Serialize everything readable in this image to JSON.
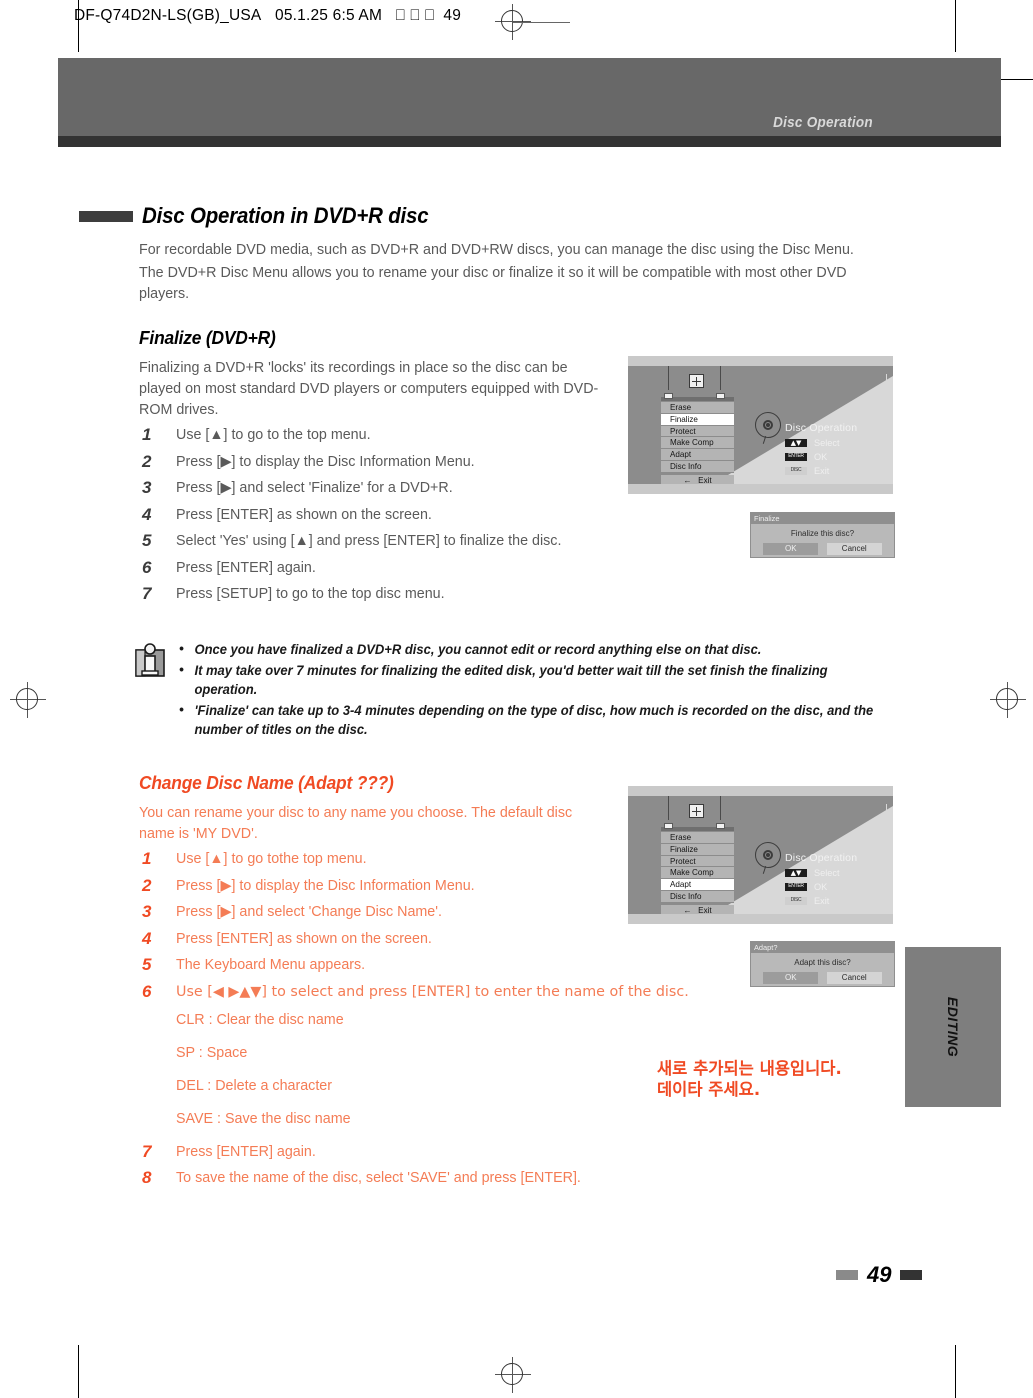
{
  "print_slug": {
    "job": "DF-Q74D2N-LS(GB)_USA",
    "date": "05.1.25 6:5 AM",
    "boxes": "⎕ ⎕ ⎕",
    "page": "49"
  },
  "header": {
    "running_title": "Disc Operation"
  },
  "chapter": {
    "title": "Disc Operation in DVD+R disc"
  },
  "intro": {
    "line1": "For recordable DVD media, such as DVD+R and DVD+RW discs, you can manage the disc using the Disc Menu.",
    "line2": "The DVD+R Disc Menu allows you to rename your disc or finalize it so it will be compatible with most other DVD players."
  },
  "finalize_section": {
    "heading": "Finalize (DVD+R)",
    "lead": "Finalizing a DVD+R 'locks' its recordings in place so the disc can be played on most standard DVD players or computers equipped with DVD-ROM drives.",
    "steps": [
      {
        "num": "1",
        "text": "Use [▲] to go to the top menu."
      },
      {
        "num": "2",
        "text": "Press [▶] to display the Disc Information Menu."
      },
      {
        "num": "3",
        "text": "Press [▶] and select 'Finalize' for a DVD+R."
      },
      {
        "num": "4",
        "text": "Press [ENTER] as shown on the screen."
      },
      {
        "num": "5",
        "text": "Select 'Yes' using [▲] and press [ENTER] to finalize the disc."
      },
      {
        "num": "6",
        "text": "Press [ENTER] again."
      },
      {
        "num": "7",
        "text": "Press [SETUP] to go to the top disc menu."
      }
    ]
  },
  "note": {
    "icon": "information-icon",
    "bullets": [
      "Once you have finalized a DVD+R disc, you cannot edit or record anything else on that disc.",
      "It may take over 7 minutes for finalizing the edited disk, you'd better wait till the set finish the finalizing operation.",
      "'Finalize' can take up to 3-4 minutes depending on the type of disc, how much is recorded on the disc, and the number of titles on the disc."
    ]
  },
  "rename_section": {
    "heading": "Change Disc Name (Adapt ???)",
    "lead": "You can rename your disc to any name you choose. The default disc name is 'MY DVD'.",
    "steps_a": [
      {
        "num": "1",
        "text": "Use [▲] to go tothe top menu."
      },
      {
        "num": "2",
        "text": "Press [▶] to display the Disc Information Menu."
      },
      {
        "num": "3",
        "text": "Press [▶] and select 'Change Disc Name'."
      },
      {
        "num": "4",
        "text": "Press [ENTER] as shown on the screen."
      },
      {
        "num": "5",
        "text": "The Keyboard Menu appears."
      },
      {
        "num": "6",
        "text": "Use [◀ ▶▲▼] to select and press [ENTER] to enter the name of the disc."
      }
    ],
    "key_defs": [
      "CLR : Clear the disc name",
      "SP : Space",
      "DEL : Delete a character",
      "SAVE : Save the disc name"
    ],
    "steps_b": [
      {
        "num": "7",
        "text": "Press [ENTER] again."
      },
      {
        "num": "8",
        "text": "To save the name of the disc, select 'SAVE' and press [ENTER]."
      }
    ]
  },
  "osd_finalize": {
    "menu_items": [
      "Erase",
      "Finalize",
      "Protect",
      "Make Comp",
      "Adapt",
      "Disc Info"
    ],
    "selected": "Finalize",
    "exit_label": "Exit",
    "exit_arrow": "←",
    "title": "Disc Operation",
    "legend": [
      {
        "key": "▲▼",
        "key_type": "arrows",
        "label": "Select"
      },
      {
        "key": "ENTER",
        "key_type": "text",
        "label": "OK"
      },
      {
        "key": "DISC",
        "key_type": "text-light",
        "label": "Exit"
      }
    ]
  },
  "osd_adapt": {
    "menu_items": [
      "Erase",
      "Finalize",
      "Protect",
      "Make Comp",
      "Adapt",
      "Disc Info"
    ],
    "selected": "Adapt",
    "exit_label": "Exit",
    "exit_arrow": "←",
    "title": "Disc Operation",
    "legend": [
      {
        "key": "▲▼",
        "key_type": "arrows",
        "label": "Select"
      },
      {
        "key": "ENTER",
        "key_type": "text",
        "label": "OK"
      },
      {
        "key": "DISC",
        "key_type": "text-light",
        "label": "Exit"
      }
    ]
  },
  "dialog_finalize": {
    "titlebar": "Finalize",
    "message": "Finalize this disc?",
    "ok": "OK",
    "cancel": "Cancel"
  },
  "dialog_adapt": {
    "titlebar": "Adapt?",
    "message": "Adapt this disc?",
    "ok": "OK",
    "cancel": "Cancel"
  },
  "korean_note": "새로 추가되는 내용입니다.\n데이타 주세요.",
  "thumb_tab": {
    "label": "EDITING"
  },
  "footer": {
    "page_number": "49"
  },
  "colors": {
    "accent": "#F04A23",
    "accent_light": "#F47C55",
    "header_band": "#686868",
    "header_underbar": "#333333",
    "osd_screen": "#8c8c8c"
  }
}
